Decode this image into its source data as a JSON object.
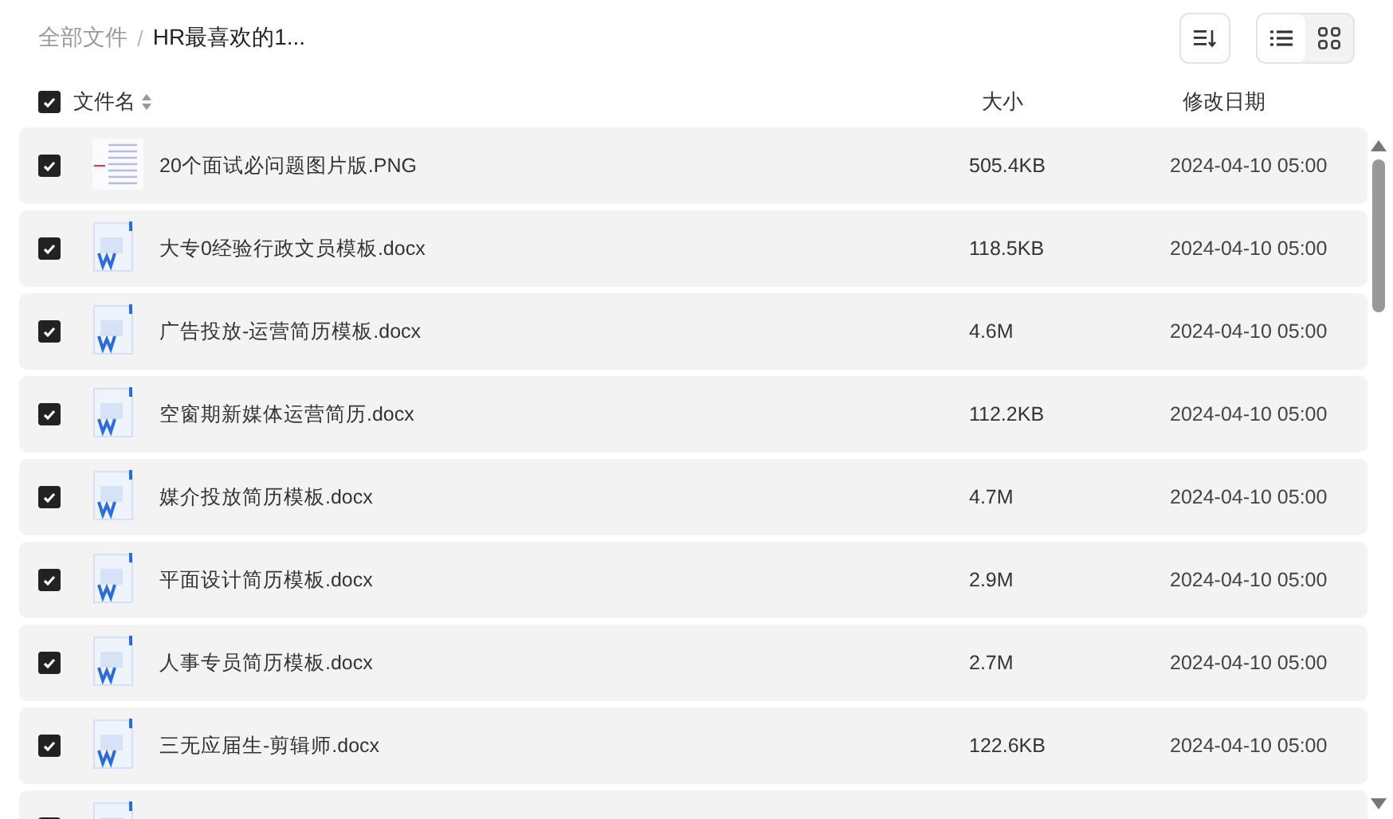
{
  "breadcrumb": [
    {
      "label": "全部文件",
      "current": false
    },
    {
      "label": "HR最喜欢的1...",
      "current": true
    }
  ],
  "breadcrumb_separator": "/",
  "view_modes": [
    {
      "kind": "list",
      "selected": true
    },
    {
      "kind": "grid",
      "selected": false
    }
  ],
  "header": {
    "checked": true,
    "columns": [
      "文件名",
      "大小",
      "修改日期"
    ]
  },
  "rows": [
    {
      "kind": "image",
      "checked": true,
      "name": "20个面试必问题图片版.PNG",
      "size": "505.4KB",
      "date": "2024-04-10 05:00"
    },
    {
      "kind": "docx",
      "checked": true,
      "name": "大专0经验行政文员模板.docx",
      "size": "118.5KB",
      "date": "2024-04-10 05:00"
    },
    {
      "kind": "docx",
      "checked": true,
      "name": "广告投放-运营简历模板.docx",
      "size": "4.6M",
      "date": "2024-04-10 05:00"
    },
    {
      "kind": "docx",
      "checked": true,
      "name": "空窗期新媒体运营简历.docx",
      "size": "112.2KB",
      "date": "2024-04-10 05:00"
    },
    {
      "kind": "docx",
      "checked": true,
      "name": "媒介投放简历模板.docx",
      "size": "4.7M",
      "date": "2024-04-10 05:00"
    },
    {
      "kind": "docx",
      "checked": true,
      "name": "平面设计简历模板.docx",
      "size": "2.9M",
      "date": "2024-04-10 05:00"
    },
    {
      "kind": "docx",
      "checked": true,
      "name": "人事专员简历模板.docx",
      "size": "2.7M",
      "date": "2024-04-10 05:00"
    },
    {
      "kind": "docx",
      "checked": true,
      "name": "三无应届生-剪辑师.docx",
      "size": "122.6KB",
      "date": "2024-04-10 05:00"
    },
    {
      "kind": "docx",
      "checked": true
    }
  ]
}
